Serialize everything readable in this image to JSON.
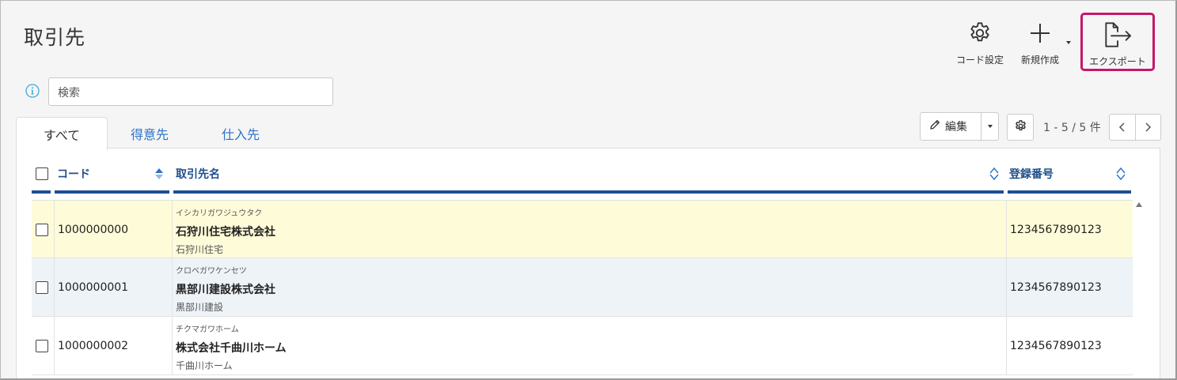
{
  "page": {
    "title": "取引先"
  },
  "toolbar": {
    "code_settings_label": "コード設定",
    "new_label": "新規作成",
    "export_label": "エクスポート"
  },
  "search": {
    "placeholder": "検索"
  },
  "tabs": [
    {
      "label": "すべて",
      "active": true
    },
    {
      "label": "得意先",
      "active": false
    },
    {
      "label": "仕入先",
      "active": false
    }
  ],
  "actions": {
    "edit_label": "編集"
  },
  "pagination": {
    "text": "1 - 5 / 5 件"
  },
  "table": {
    "columns": [
      {
        "label": "コード"
      },
      {
        "label": "取引先名"
      },
      {
        "label": "登録番号"
      }
    ],
    "rows": [
      {
        "code": "1000000000",
        "kana": "イシカリガワジュウタク",
        "name": "石狩川住宅株式会社",
        "short_name": "石狩川住宅",
        "reg_no": "1234567890123",
        "highlight": true
      },
      {
        "code": "1000000001",
        "kana": "クロベガワケンセツ",
        "name": "黒部川建設株式会社",
        "short_name": "黒部川建設",
        "reg_no": "1234567890123",
        "highlight": false
      },
      {
        "code": "1000000002",
        "kana": "チクマガワホーム",
        "name": "株式会社千曲川ホーム",
        "short_name": "千曲川ホーム",
        "reg_no": "1234567890123",
        "highlight": false
      }
    ]
  },
  "colors": {
    "accent_blue": "#1e4f95",
    "link_blue": "#2b73c8",
    "export_highlight": "#c41769",
    "selected_row": "#fefbd8",
    "hover_row": "#eef3f8"
  }
}
